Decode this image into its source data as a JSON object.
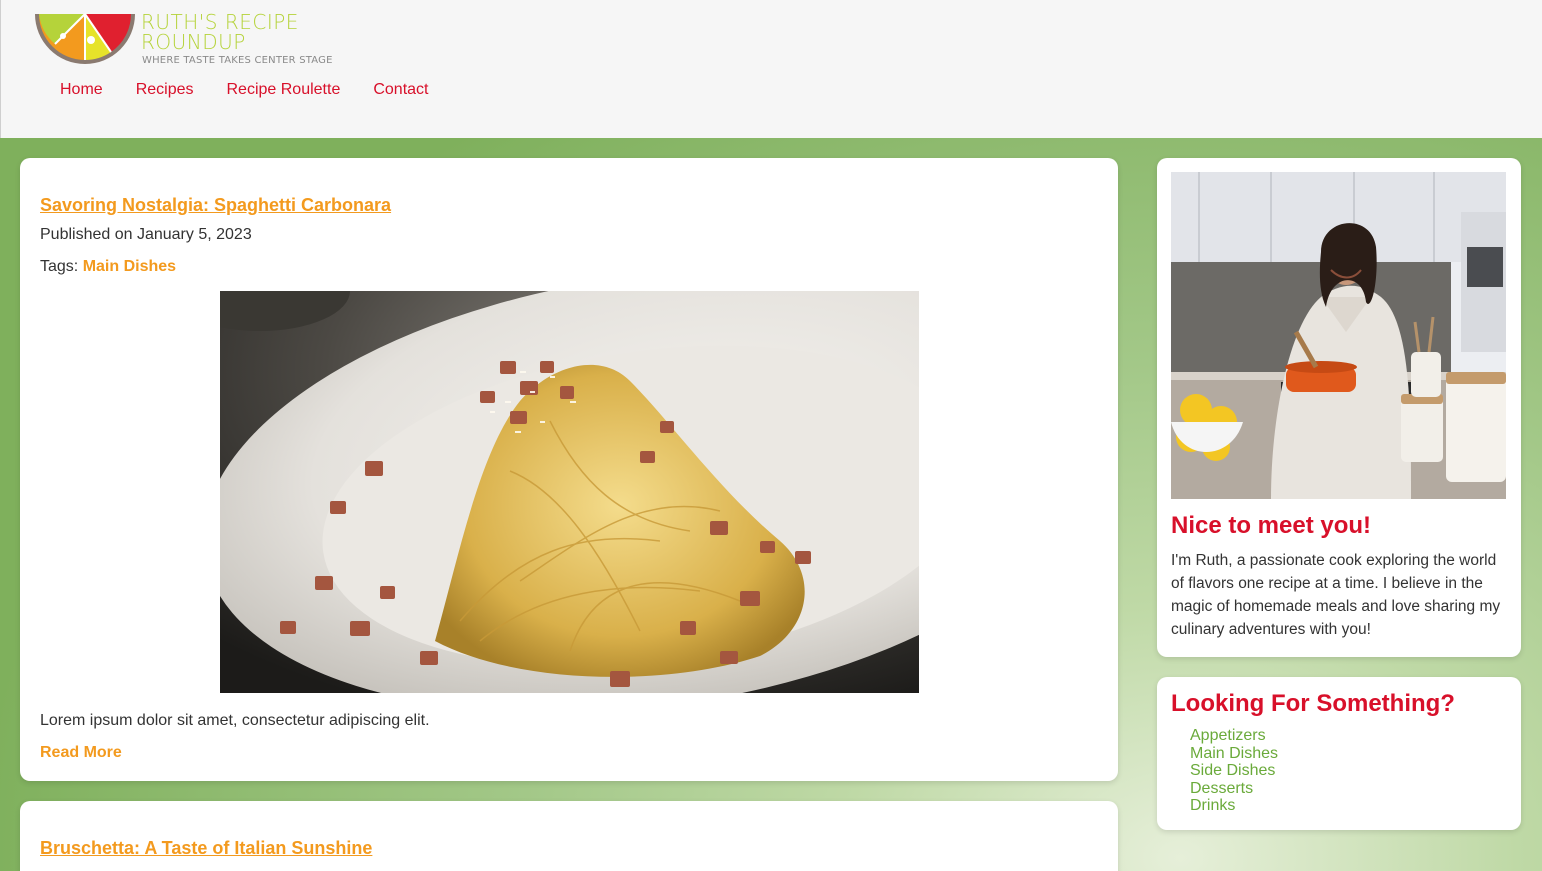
{
  "brand": {
    "title_line1": "RUTH'S RECIPE",
    "title_line2": "ROUNDUP",
    "tagline": "WHERE TASTE TAKES CENTER STAGE",
    "colors": {
      "orange": "#f39a1e",
      "lime": "#b5d33a",
      "red": "#e0202f",
      "brown": "#8a7a70"
    }
  },
  "nav": {
    "items": [
      {
        "label": "Home"
      },
      {
        "label": "Recipes"
      },
      {
        "label": "Recipe Roulette"
      },
      {
        "label": "Contact"
      }
    ]
  },
  "posts": [
    {
      "title": "Savoring Nostalgia: Spaghetti Carbonara",
      "date": "Published on January 5, 2023",
      "tags_label": "Tags:",
      "tag": "Main Dishes",
      "image_alt": "Spaghetti Carbonara",
      "excerpt": "Lorem ipsum dolor sit amet, consectetur adipiscing elit.",
      "read_more": "Read More"
    },
    {
      "title": "Bruschetta: A Taste of Italian Sunshine"
    }
  ],
  "about": {
    "image_alt": "Ruth cooking in her kitchen",
    "heading": "Nice to meet you!",
    "text": "I'm Ruth, a passionate cook exploring the world of flavors one recipe at a time. I believe in the magic of homemade meals and love sharing my culinary adventures with you!"
  },
  "search": {
    "heading": "Looking For Something?",
    "categories": [
      {
        "label": "Appetizers"
      },
      {
        "label": "Main Dishes"
      },
      {
        "label": "Side Dishes"
      },
      {
        "label": "Desserts"
      },
      {
        "label": "Drinks"
      }
    ]
  },
  "theme": {
    "link_red": "#d8102a",
    "accent_orange": "#f39a1e",
    "category_green": "#6aaa3a",
    "background_green": "#8fbd6c"
  }
}
